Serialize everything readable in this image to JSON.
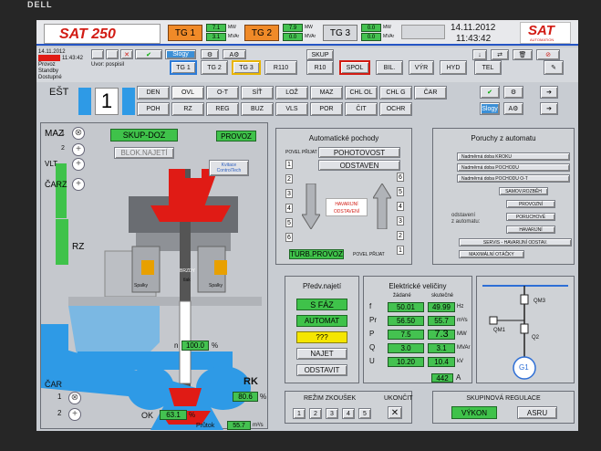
{
  "header": {
    "brand": "SAT 250",
    "tg1": {
      "label": "TG 1",
      "mw": "7.1",
      "mvar": "3.1",
      "mw_unit": "MW",
      "mvar_unit": "MVAr"
    },
    "tg2": {
      "label": "TG 2",
      "mw": "7.9",
      "mvar": "0.0",
      "mw_unit": "MW",
      "mvar_unit": "MVAr"
    },
    "tg3": {
      "label": "TG 3",
      "mw": "0.0",
      "mvar": "0.0",
      "mw_unit": "MW",
      "mvar_unit": "MVAr"
    },
    "date": "14.11.2012",
    "time": "11:43:42",
    "logo": "SAT",
    "logo_sub": "AUTOMATION"
  },
  "status": {
    "date": "14.11.2012",
    "time": "11:43:42",
    "mode": "Provoz",
    "state2": "Standby",
    "state3": "Dostupné",
    "user": "Uvor: pospisil",
    "slv": "Slv",
    "slogy": "Slogy"
  },
  "toolbar": {
    "skup": "SKUP",
    "tg1": "TG 1",
    "tg2": "TG 2",
    "tg3": "TG 3",
    "r110": "R110",
    "r10": "R10",
    "spol": "SPOL",
    "bil": "BIL.",
    "vyr": "VÝR",
    "hyd": "HYD",
    "tel": "TEL"
  },
  "unit": {
    "label": "EŠT",
    "number": "1"
  },
  "nav": {
    "row1": [
      "DEN",
      "OVL",
      "O-T",
      "SÍŤ",
      "LOŽ",
      "MAZ",
      "CHL OL",
      "CHL G",
      "ČAR"
    ],
    "row2": [
      "POH",
      "RZ",
      "REG",
      "BUZ",
      "VLS",
      "POR",
      "ČIT",
      "OCHR"
    ]
  },
  "diagram": {
    "maz": "MAZ",
    "vlt": "VLT",
    "carz": "ČARZ",
    "rz": "RZ",
    "car": "ČAR",
    "skup_doz": "SKUP-DOZ",
    "provoz": "PROVOZ",
    "blok_najeti": "BLOK.NAJETÍ",
    "kvitace": "Kvitace\nControlTech",
    "spalky": "Spalky",
    "tlak": "tlak",
    "brzdy": "BRZDY",
    "n_label": "n",
    "n_value": "100.0",
    "n_unit": "%",
    "ok_label": "OK",
    "ok_value": "63.1",
    "ok_unit": "%",
    "rk_label": "RK",
    "rk_value": "80.6",
    "rk_unit": "%",
    "prutok_label": "Průtok",
    "prutok_value": "55.7",
    "prutok_unit": "m³/s",
    "nums": [
      "1",
      "2"
    ]
  },
  "auto": {
    "title": "Automatické pochody",
    "povel_prijat": "POVEL PŘIJAT",
    "pohotovost": "POHOTOVOST",
    "odstaven": "ODSTAVEN",
    "havarijni": "HAVARIJNÍ ODSTAVENÍ",
    "turb_provoz": "TURB.PROVOZ",
    "povel_prijat2": "POVEL PŘIJAT",
    "left_nums": [
      "1",
      "2",
      "3",
      "4",
      "5",
      "6"
    ],
    "right_nums": [
      "6",
      "5",
      "4",
      "3",
      "2",
      "1"
    ]
  },
  "faults": {
    "title": "Poruchy z automatu",
    "items": [
      "Nadměrná doba KROKU",
      "Nadměrná doba POCHODU",
      "Nadměrná doba POCHODU O-T",
      "SAMOV.ROZBĚH"
    ],
    "odstaveni": "odstavení\nz automatu:",
    "items2": [
      "PROVOZNÍ",
      "PORUCHOVÉ",
      "HAVARIJNÍ"
    ],
    "servis": "SERVIS - HAVARIJNÍ ODSTAV.",
    "max": "MAXIMÁLNÍ OTÁČKY"
  },
  "prestart": {
    "title": "Předv.najetí",
    "buttons": [
      "S FÁZ",
      "AUTOMAT",
      "???",
      "NAJET",
      "ODSTAVIT"
    ]
  },
  "elec": {
    "title": "Elektrické veličiny",
    "col1": "žádané",
    "col2": "skutečné",
    "rows": [
      {
        "label": "f",
        "set": "50.01",
        "act": "49.99",
        "unit": "Hz"
      },
      {
        "label": "Pr",
        "set": "56.50",
        "act": "55.7",
        "unit": "m³/s"
      },
      {
        "label": "P",
        "set": "7.5",
        "act": "7.3",
        "unit": "MW"
      },
      {
        "label": "Q",
        "set": "3.0",
        "act": "3.1",
        "unit": "MVAr"
      },
      {
        "label": "U",
        "set": "10.20",
        "act": "10.4",
        "unit": "kV"
      }
    ],
    "current": "442",
    "current_unit": "A"
  },
  "switch": {
    "qm3": "QM3",
    "qm1": "QM1",
    "q2": "Q2",
    "gen": "G1"
  },
  "test": {
    "title": "REŽIM ZKOUŠEK",
    "nums": [
      "1",
      "2",
      "3",
      "4",
      "5"
    ],
    "ukoncit": "UKONČIT"
  },
  "group": {
    "title": "SKUPINOVÁ REGULACE",
    "vykon": "VÝKON",
    "asru": "ASRU"
  },
  "colors": {
    "bg": "#c8ccd2",
    "green": "#44c250",
    "red": "#e01b15",
    "blue": "#2e9ae6",
    "orange": "#f08a28"
  }
}
